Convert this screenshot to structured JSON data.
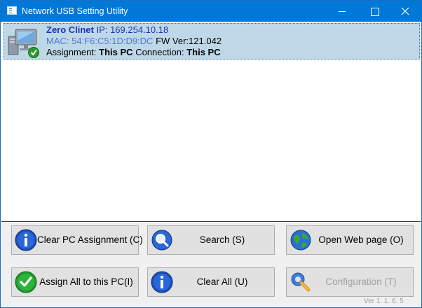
{
  "window": {
    "title": "Network USB Setting Utility"
  },
  "device": {
    "name": "Zero Clinet",
    "ip_label": "IP:",
    "ip": "169.254.10.18",
    "mac_label": "MAC:",
    "mac": "54:F6:C5:1D:D9:DC",
    "fw_label": "FW Ver:",
    "fw": "121.042",
    "assignment_label": "Assignment:",
    "assignment": "This PC",
    "connection_label": "Connection:",
    "connection": "This PC"
  },
  "buttons": {
    "clear_pc_assignment": "Clear PC Assignment (C)",
    "search": "Search (S)",
    "open_web_page": "Open Web page (O)",
    "assign_all": "Assign All  to this PC(I)",
    "clear_all": "Clear All (U)",
    "configuration": "Configuration (T)"
  },
  "status": {
    "version": "Ver 1. 1. 6. 5"
  },
  "icons": {
    "app": "window-icon",
    "pc": "computer-check-icon",
    "info": "info-icon",
    "search": "search-icon",
    "globe": "globe-icon",
    "check": "check-icon",
    "config": "wrench-icon"
  },
  "colors": {
    "accent": "#0078d7",
    "selection": "#bfd8e8",
    "device_name": "#1734b5"
  }
}
